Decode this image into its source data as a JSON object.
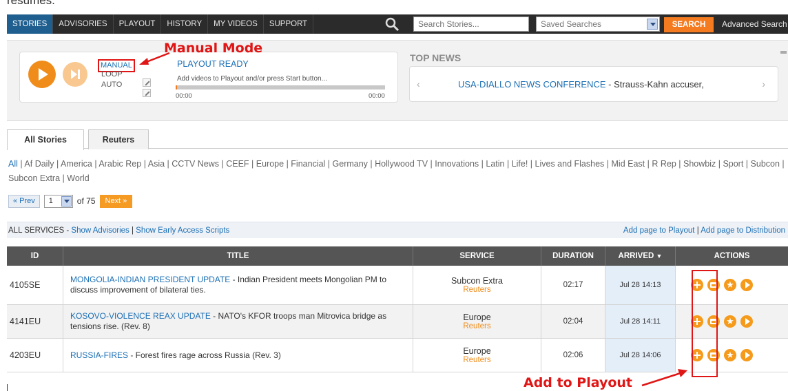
{
  "caption_fragment": "resumes.",
  "nav": {
    "tabs": [
      "STORIES",
      "ADVISORIES",
      "PLAYOUT",
      "HISTORY",
      "MY VIDEOS",
      "SUPPORT"
    ],
    "search_placeholder": "Search Stories...",
    "saved_searches": "Saved Searches",
    "search_button": "SEARCH",
    "advanced": "Advanced Search"
  },
  "player": {
    "mode_manual": "MANUAL",
    "mode_loop": "LOOP",
    "mode_auto": "AUTO",
    "status": "PLAYOUT READY",
    "message": "Add videos to Playout and/or press Start button...",
    "time_start": "00:00",
    "time_end": "00:00",
    "progress": 0
  },
  "top_news": {
    "title": "TOP NEWS",
    "headline": "USA-DIALLO NEWS CONFERENCE",
    "headline_rest": " - Strauss-Kahn accuser,"
  },
  "annotations": {
    "manual_mode": "Manual Mode",
    "add_to_playout": "Add to Playout"
  },
  "story_tabs": [
    "All Stories",
    "Reuters"
  ],
  "categories": [
    "All",
    "Af Daily",
    "America",
    "Arabic Rep",
    "Asia",
    "CCTV News",
    "CEEF",
    "Europe",
    "Financial",
    "Germany",
    "Hollywood TV",
    "Innovations",
    "Latin",
    "Life!",
    "Lives and Flashes",
    "Mid East",
    "R Rep",
    "Showbiz",
    "Sport",
    "Subcon",
    "Subcon Extra",
    "World"
  ],
  "pager": {
    "prev": "« Prev",
    "page": "1",
    "of": "of 75",
    "next": "Next »"
  },
  "services": {
    "label": "ALL SERVICES - ",
    "show_advisories": "Show Advisories",
    "separator": " | ",
    "show_early": "Show Early Access Scripts",
    "add_playout": "Add page to Playout",
    "add_distribution": "Add page to Distribution"
  },
  "table": {
    "headers": [
      "ID",
      "TITLE",
      "SERVICE",
      "DURATION",
      "ARRIVED",
      "ACTIONS"
    ],
    "rows": [
      {
        "id": "4105SE",
        "title_link": "MONGOLIA-INDIAN PRESIDENT UPDATE",
        "title_rest": " - Indian President meets Mongolian PM to discuss improvement of bilateral ties.",
        "service": "Subcon Extra",
        "provider": "Reuters",
        "duration": "02:17",
        "arrived": "Jul 28 14:13"
      },
      {
        "id": "4141EU",
        "title_link": "KOSOVO-VIOLENCE REAX UPDATE",
        "title_rest": " - NATO's KFOR troops man Mitrovica bridge as tensions rise. (Rev. 8)",
        "service": "Europe",
        "provider": "Reuters",
        "duration": "02:04",
        "arrived": "Jul 28 14:11"
      },
      {
        "id": "4203EU",
        "title_link": "RUSSIA-FIRES",
        "title_rest": " - Forest fires rage across Russia (Rev. 3)",
        "service": "Europe",
        "provider": "Reuters",
        "duration": "02:06",
        "arrived": "Jul 28 14:06"
      }
    ]
  },
  "colors": {
    "accent_orange": "#f59a1a",
    "link_blue": "#1b6fb5",
    "annotation_red": "#e01515",
    "nav_bg": "#2b2b2b"
  }
}
